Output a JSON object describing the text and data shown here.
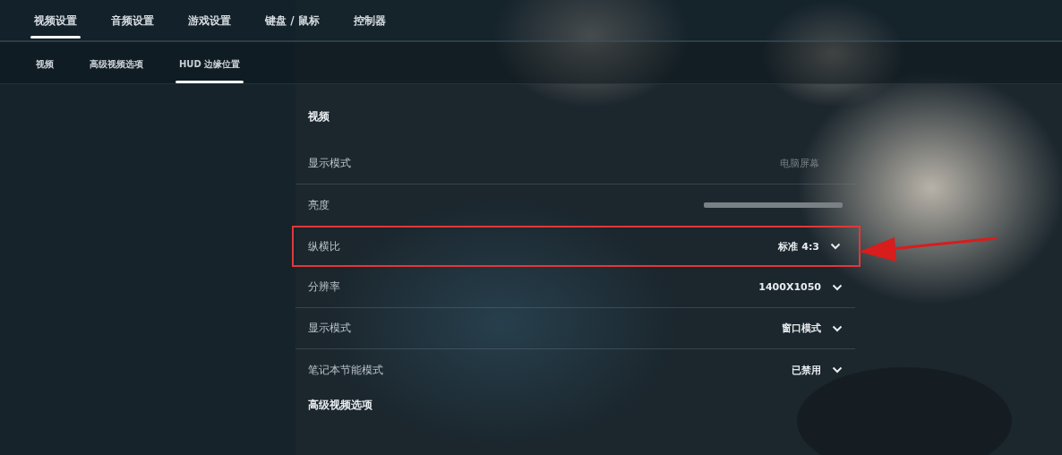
{
  "tabs": [
    {
      "label": "视频设置",
      "selected": true
    },
    {
      "label": "音频设置",
      "selected": false
    },
    {
      "label": "游戏设置",
      "selected": false
    },
    {
      "label": "键盘 / 鼠标",
      "selected": false
    },
    {
      "label": "控制器",
      "selected": false
    }
  ],
  "subtabs": [
    {
      "label": "视频",
      "selected": false
    },
    {
      "label": "高级视频选项",
      "selected": false
    },
    {
      "label": "HUD 边缘位置",
      "selected": true
    }
  ],
  "sections": [
    {
      "title": "视频",
      "rows": [
        {
          "label": "显示模式",
          "kind": "text",
          "value": "电脑屏幕",
          "disabled": true,
          "highlighted": false,
          "divider": true
        },
        {
          "label": "亮度",
          "kind": "slider",
          "level": 1,
          "highlighted": false,
          "divider": false
        },
        {
          "label": "纵横比",
          "kind": "dropdown",
          "value": "标准 4:3",
          "highlighted": true,
          "divider": false
        },
        {
          "label": "分辨率",
          "kind": "dropdown",
          "value": "1400X1050",
          "highlighted": false,
          "divider": true
        },
        {
          "label": "显示模式",
          "kind": "dropdown",
          "value": "窗口模式",
          "highlighted": false,
          "divider": true
        },
        {
          "label": "笔记本节能模式",
          "kind": "dropdown",
          "value": "已禁用",
          "highlighted": false,
          "divider": false
        }
      ]
    },
    {
      "title": "高级视频选项"
    }
  ]
}
